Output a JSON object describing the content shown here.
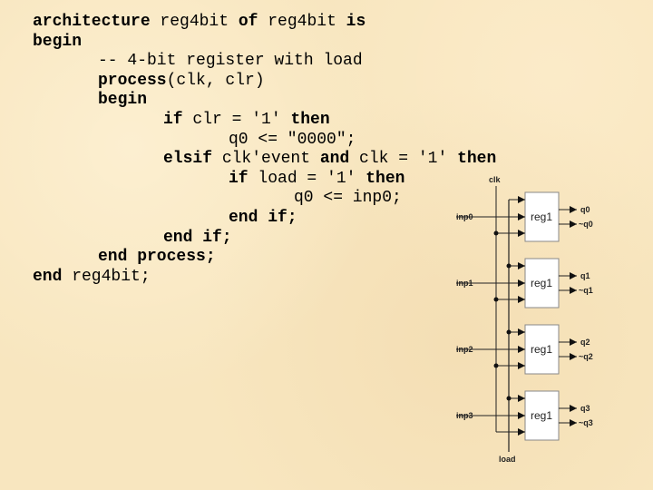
{
  "code": [
    {
      "indent": 0,
      "parts": [
        {
          "t": "architecture",
          "b": true
        },
        {
          "t": " reg4bit ",
          "b": false
        },
        {
          "t": "of",
          "b": true
        },
        {
          "t": " reg4bit ",
          "b": false
        },
        {
          "t": "is",
          "b": true
        }
      ]
    },
    {
      "indent": 0,
      "parts": [
        {
          "t": "begin",
          "b": true
        }
      ]
    },
    {
      "indent": 1,
      "parts": [
        {
          "t": "-- 4-bit register with load",
          "b": false
        }
      ]
    },
    {
      "indent": 1,
      "parts": [
        {
          "t": "process",
          "b": true
        },
        {
          "t": "(clk, clr)",
          "b": false
        }
      ]
    },
    {
      "indent": 1,
      "parts": [
        {
          "t": "begin",
          "b": true
        }
      ]
    },
    {
      "indent": 2,
      "parts": [
        {
          "t": "if",
          "b": true
        },
        {
          "t": " clr = '1' ",
          "b": false
        },
        {
          "t": "then",
          "b": true
        }
      ]
    },
    {
      "indent": 3,
      "parts": [
        {
          "t": "q0 <= \"0000\";",
          "b": false
        }
      ]
    },
    {
      "indent": 2,
      "parts": [
        {
          "t": "elsif",
          "b": true
        },
        {
          "t": " clk'event ",
          "b": false
        },
        {
          "t": "and",
          "b": true
        },
        {
          "t": " clk = '1' ",
          "b": false
        },
        {
          "t": "then",
          "b": true
        }
      ]
    },
    {
      "indent": 3,
      "parts": [
        {
          "t": "if",
          "b": true
        },
        {
          "t": " load = '1' ",
          "b": false
        },
        {
          "t": "then",
          "b": true
        }
      ]
    },
    {
      "indent": 4,
      "parts": [
        {
          "t": "q0 <= inp0;",
          "b": false
        }
      ]
    },
    {
      "indent": 3,
      "parts": [
        {
          "t": "end if;",
          "b": true
        }
      ]
    },
    {
      "indent": 2,
      "parts": [
        {
          "t": "end if;",
          "b": true
        }
      ]
    },
    {
      "indent": 1,
      "parts": [
        {
          "t": "end process;",
          "b": true
        }
      ]
    },
    {
      "indent": 0,
      "parts": [
        {
          "t": "end",
          "b": true
        },
        {
          "t": " reg4bit;",
          "b": false
        }
      ]
    }
  ],
  "diagram": {
    "clk_label": "clk",
    "load_label": "load",
    "registers": [
      {
        "name": "reg1",
        "input": "inp0",
        "q": "q0",
        "qbar": "~q0"
      },
      {
        "name": "reg1",
        "input": "inp1",
        "q": "q1",
        "qbar": "~q1"
      },
      {
        "name": "reg1",
        "input": "inp2",
        "q": "q2",
        "qbar": "~q2"
      },
      {
        "name": "reg1",
        "input": "inp3",
        "q": "q3",
        "qbar": "~q3"
      }
    ]
  }
}
